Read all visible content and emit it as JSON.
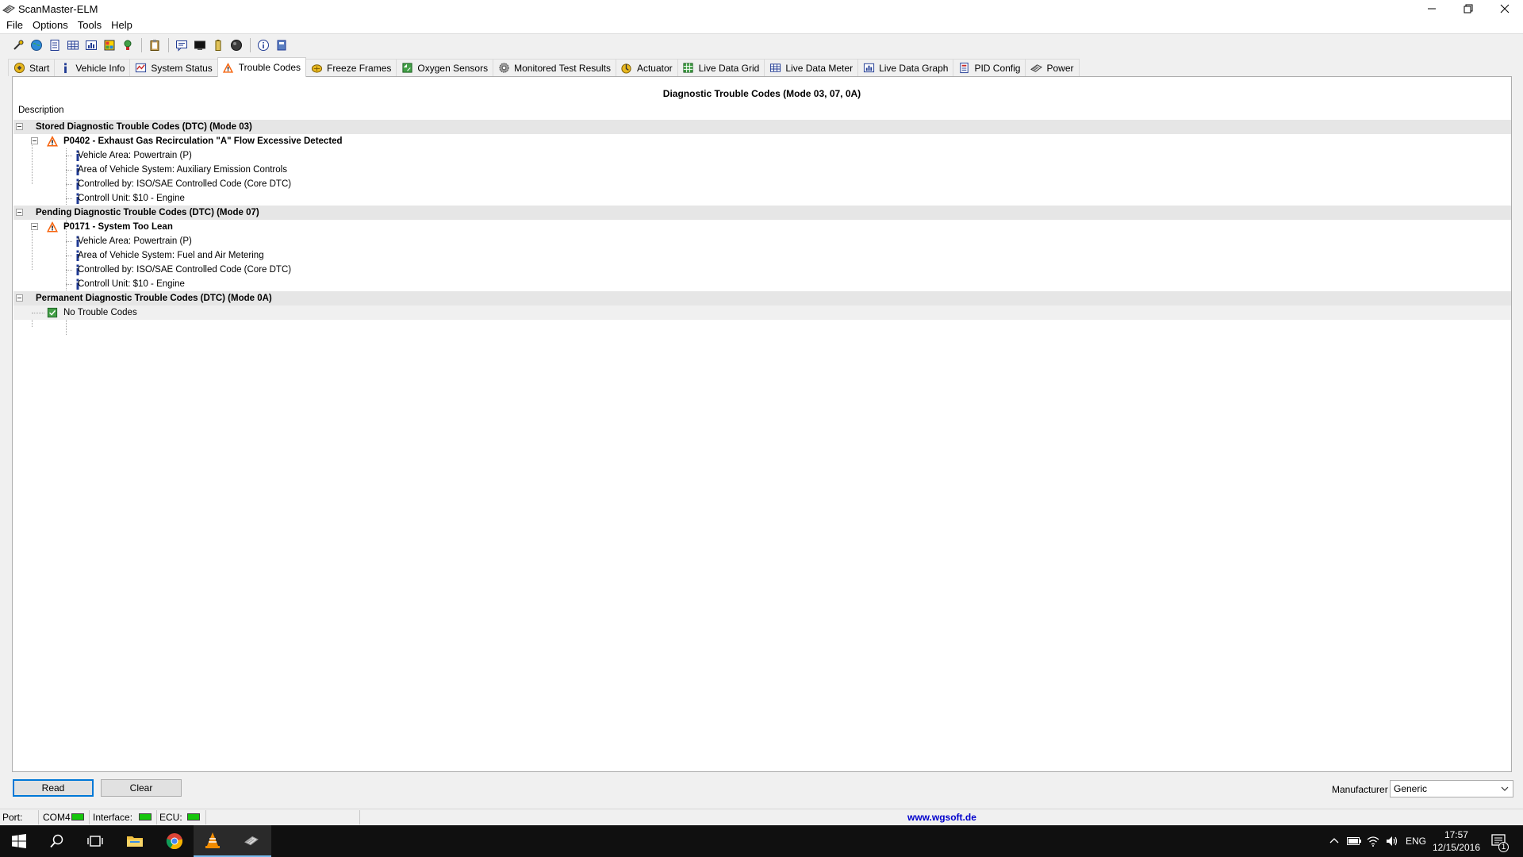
{
  "window": {
    "title": "ScanMaster-ELM"
  },
  "menu": [
    "File",
    "Options",
    "Tools",
    "Help"
  ],
  "toolbar_icons": [
    "connect-icon",
    "globe-icon",
    "document-icon",
    "grid-icon",
    "chart-icon",
    "palette-icon",
    "bulb-icon",
    "clipboard-icon",
    "chat-icon",
    "monitor-icon",
    "battery-icon",
    "ball-icon",
    "info-icon",
    "book-icon"
  ],
  "tabs": [
    {
      "label": "Start",
      "icon": "start-icon"
    },
    {
      "label": "Vehicle Info",
      "icon": "info-icon"
    },
    {
      "label": "System Status",
      "icon": "status-icon"
    },
    {
      "label": "Trouble Codes",
      "icon": "warning-icon",
      "active": true
    },
    {
      "label": "Freeze Frames",
      "icon": "freeze-icon"
    },
    {
      "label": "Oxygen Sensors",
      "icon": "sensor-icon"
    },
    {
      "label": "Monitored Test Results",
      "icon": "gear-icon"
    },
    {
      "label": "Actuator",
      "icon": "actuator-icon"
    },
    {
      "label": "Live Data Grid",
      "icon": "grid-icon"
    },
    {
      "label": "Live Data Meter",
      "icon": "meter-icon"
    },
    {
      "label": "Live Data Graph",
      "icon": "graph-icon"
    },
    {
      "label": "PID Config",
      "icon": "config-icon"
    },
    {
      "label": "Power",
      "icon": "power-icon"
    }
  ],
  "panel": {
    "title": "Diagnostic Trouble Codes (Mode 03, 07, 0A)",
    "column_header": "Description"
  },
  "tree": {
    "stored": {
      "label": "Stored Diagnostic Trouble Codes (DTC) (Mode 03)",
      "code": "P0402 - Exhaust Gas Recirculation \"A\" Flow Excessive Detected",
      "details": [
        "Vehicle Area: Powertrain (P)",
        "Area of Vehicle System: Auxiliary Emission Controls",
        "Controlled by: ISO/SAE Controlled Code (Core DTC)",
        "Controll Unit: $10 - Engine"
      ]
    },
    "pending": {
      "label": "Pending Diagnostic Trouble Codes (DTC) (Mode 07)",
      "code": "P0171 - System Too Lean",
      "details": [
        "Vehicle Area: Powertrain (P)",
        "Area of Vehicle System: Fuel and Air Metering",
        "Controlled by: ISO/SAE Controlled Code (Core DTC)",
        "Controll Unit: $10 - Engine"
      ]
    },
    "permanent": {
      "label": "Permanent Diagnostic Trouble Codes (DTC) (Mode 0A)",
      "none": "No Trouble Codes"
    }
  },
  "buttons": {
    "read": "Read",
    "clear": "Clear"
  },
  "manufacturer": {
    "label": "Manufacturer",
    "value": "Generic"
  },
  "status": {
    "port_label": "Port:",
    "port_value": "COM4",
    "interface_label": "Interface:",
    "ecu_label": "ECU:",
    "link": "www.wgsoft.de"
  },
  "taskbar": {
    "language": "ENG",
    "time": "17:57",
    "date": "12/15/2016",
    "notification_count": "1"
  },
  "colors": {
    "led": "#16c60c",
    "warning": "#f7630c",
    "link": "#0000cc",
    "info": "#1f3a93"
  }
}
